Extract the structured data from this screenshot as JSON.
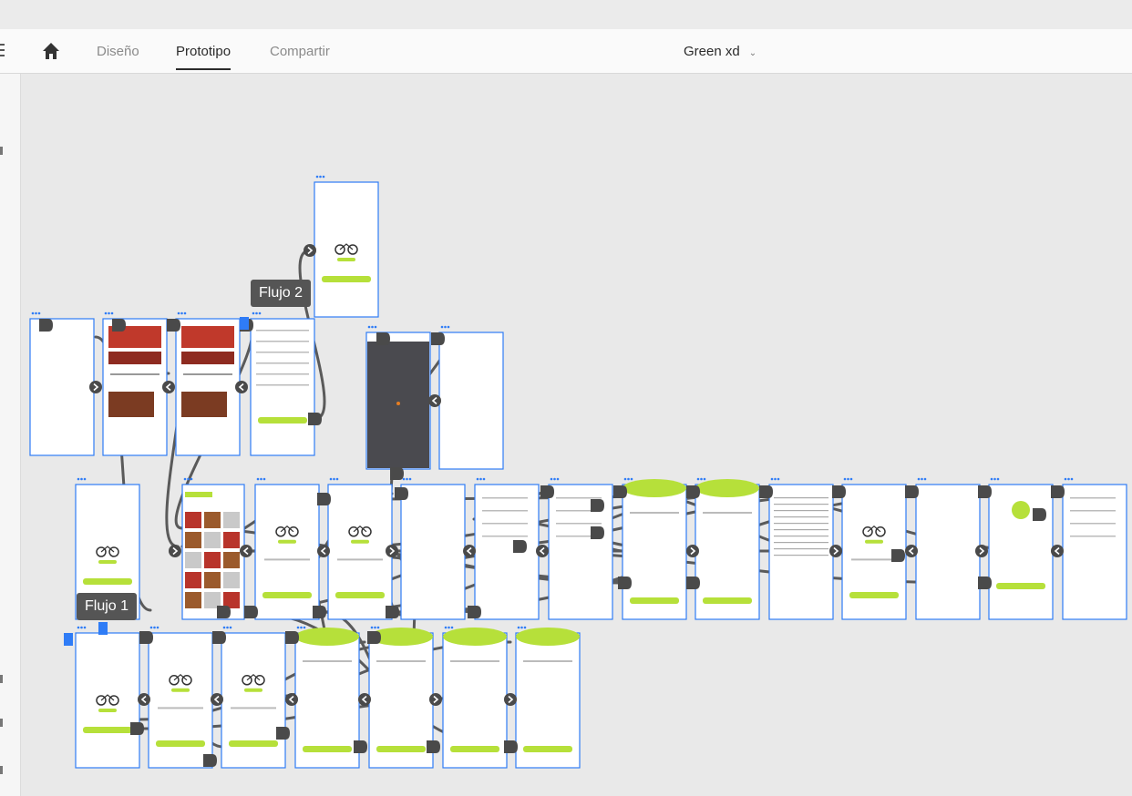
{
  "topbar": {
    "tabs": [
      {
        "label": "Diseño",
        "active": false
      },
      {
        "label": "Prototipo",
        "active": true
      },
      {
        "label": "Compartir",
        "active": false
      }
    ],
    "document_title": "Green xd",
    "home_icon": "home-icon",
    "menu_icon": "hamburger-menu-icon"
  },
  "canvas": {
    "flows": [
      {
        "label": "Flujo 2"
      },
      {
        "label": "Flujo 1"
      }
    ],
    "accent_color": "#b6e03a",
    "selection_color": "#2f7cf6",
    "wire_color": "#5a5a5a"
  }
}
